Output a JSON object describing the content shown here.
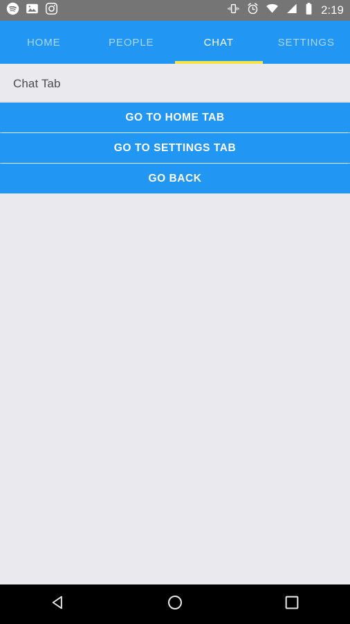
{
  "status_bar": {
    "background": "#757575",
    "left_icons": [
      {
        "name": "spotify-icon",
        "label": "Spotify"
      },
      {
        "name": "photos-icon",
        "label": "Photos"
      },
      {
        "name": "instagram-icon",
        "label": "Instagram"
      }
    ],
    "right_icons": [
      {
        "name": "vibrate-icon",
        "label": "Vibrate"
      },
      {
        "name": "alarm-icon",
        "label": "Alarm"
      },
      {
        "name": "wifi-icon",
        "label": "Wi-Fi"
      },
      {
        "name": "cell-signal-icon",
        "label": "Cell signal"
      },
      {
        "name": "battery-icon",
        "label": "Battery"
      }
    ],
    "clock": "2:19"
  },
  "tab_bar": {
    "background": "#2196f3",
    "indicator_color": "#f7e34a",
    "active_index": 2,
    "tabs": [
      {
        "label": "HOME"
      },
      {
        "label": "PEOPLE"
      },
      {
        "label": "CHAT"
      },
      {
        "label": "SETTINGS"
      }
    ]
  },
  "content": {
    "background": "#e9e9ee",
    "header_text": "Chat Tab",
    "buttons": [
      {
        "label": "GO TO HOME TAB"
      },
      {
        "label": "GO TO SETTINGS TAB"
      },
      {
        "label": "GO BACK"
      }
    ],
    "button_color": "#2196f3",
    "button_text_color": "#ffffff"
  },
  "nav_bar": {
    "background": "#000000",
    "buttons": [
      {
        "name": "back-icon",
        "label": "Back"
      },
      {
        "name": "home-icon",
        "label": "Home"
      },
      {
        "name": "recents-icon",
        "label": "Recent apps"
      }
    ]
  }
}
